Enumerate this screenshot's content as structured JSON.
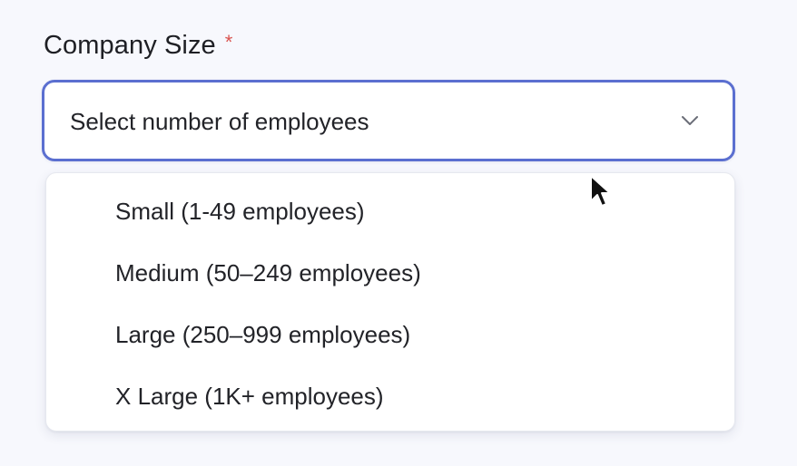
{
  "field": {
    "label": "Company Size",
    "required_marker": "*"
  },
  "select": {
    "placeholder": "Select number of employees",
    "icon": "chevron-down-icon"
  },
  "options": [
    {
      "label": "Small (1-49 employees)"
    },
    {
      "label": "Medium (50–249 employees)"
    },
    {
      "label": "Large (250–999 employees)"
    },
    {
      "label": "X Large (1K+ employees)"
    }
  ],
  "colors": {
    "focus_border": "#5b6fd0",
    "required": "#d9534f",
    "background": "#f7f8fd"
  }
}
